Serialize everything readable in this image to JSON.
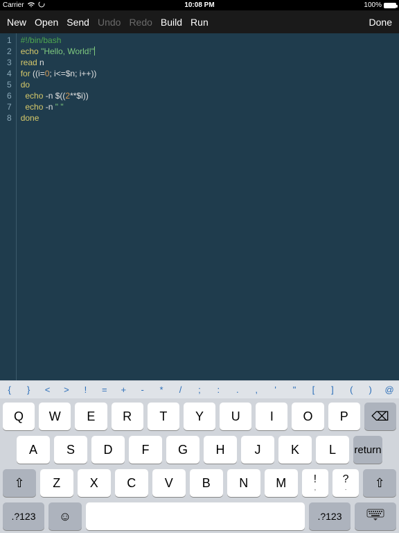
{
  "status": {
    "carrier": "Carrier",
    "time": "10:08 PM",
    "battery": "100%"
  },
  "toolbar": {
    "new": "New",
    "open": "Open",
    "send": "Send",
    "undo": "Undo",
    "redo": "Redo",
    "build": "Build",
    "run": "Run",
    "done": "Done"
  },
  "editor": {
    "lines": [
      {
        "n": "1",
        "tokens": [
          {
            "c": "tok-comment",
            "t": "#!/bin/bash"
          }
        ]
      },
      {
        "n": "2",
        "tokens": [
          {
            "c": "tok-builtin",
            "t": "echo"
          },
          {
            "c": "",
            "t": " "
          },
          {
            "c": "tok-string",
            "t": "\"Hello, World!\""
          }
        ],
        "cursorAfter": true
      },
      {
        "n": "3",
        "tokens": [
          {
            "c": "tok-builtin",
            "t": "read"
          },
          {
            "c": "",
            "t": " n"
          }
        ]
      },
      {
        "n": "4",
        "tokens": [
          {
            "c": "tok-keyword",
            "t": "for"
          },
          {
            "c": "",
            "t": " ((i="
          },
          {
            "c": "tok-num",
            "t": "0"
          },
          {
            "c": "",
            "t": "; i<=$n; i++))"
          }
        ]
      },
      {
        "n": "5",
        "tokens": [
          {
            "c": "tok-keyword",
            "t": "do"
          }
        ]
      },
      {
        "n": "6",
        "tokens": [
          {
            "c": "",
            "t": "  "
          },
          {
            "c": "tok-builtin",
            "t": "echo"
          },
          {
            "c": "",
            "t": " -n $(("
          },
          {
            "c": "tok-num",
            "t": "2"
          },
          {
            "c": "",
            "t": "**$i))"
          }
        ]
      },
      {
        "n": "7",
        "tokens": [
          {
            "c": "",
            "t": "  "
          },
          {
            "c": "tok-builtin",
            "t": "echo"
          },
          {
            "c": "",
            "t": " -n "
          },
          {
            "c": "tok-string",
            "t": "\" \""
          }
        ]
      },
      {
        "n": "8",
        "tokens": [
          {
            "c": "tok-keyword",
            "t": "done"
          }
        ]
      }
    ]
  },
  "symrow": [
    "{",
    "}",
    "<",
    ">",
    "!",
    "=",
    "+",
    "-",
    "*",
    "/",
    ";",
    ":",
    ".",
    ",",
    "'",
    "\"",
    "[",
    "]",
    "(",
    ")",
    "@"
  ],
  "keyboard": {
    "row1": [
      "Q",
      "W",
      "E",
      "R",
      "T",
      "Y",
      "U",
      "I",
      "O",
      "P"
    ],
    "row2": [
      "A",
      "S",
      "D",
      "F",
      "G",
      "H",
      "J",
      "K",
      "L"
    ],
    "row3": [
      "Z",
      "X",
      "C",
      "V",
      "B",
      "N",
      "M"
    ],
    "punct1": {
      "main": "!",
      "sub": ","
    },
    "punct2": {
      "main": "?",
      "sub": "."
    },
    "return": "return",
    "mode": ".?123",
    "backspace_icon": "⌫",
    "shift_icon": "⇧",
    "emoji_icon": "☺",
    "hide_icon": "⌨"
  }
}
